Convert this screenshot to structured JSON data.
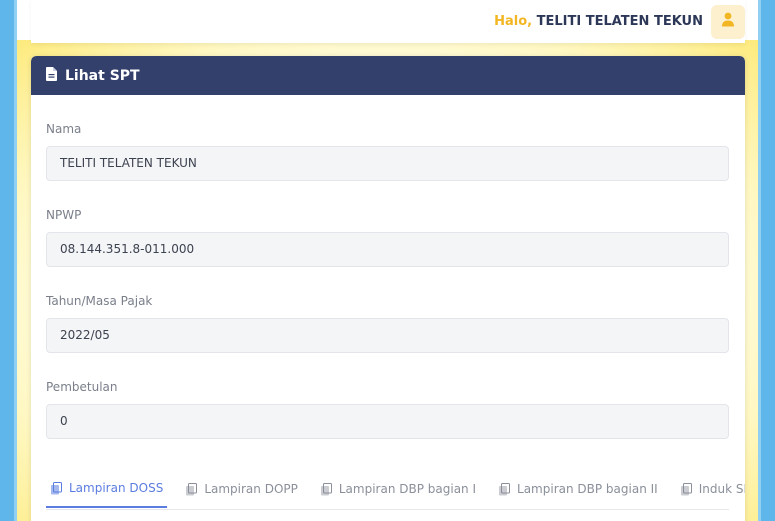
{
  "header": {
    "greeting": "Halo,",
    "user_name": "TELITI TELATEN TEKUN",
    "avatar_icon": "user-icon"
  },
  "card": {
    "title": "Lihat SPT",
    "title_icon": "document-icon"
  },
  "fields": {
    "nama": {
      "label": "Nama",
      "value": "TELITI TELATEN TEKUN"
    },
    "npwp": {
      "label": "NPWP",
      "value": "08.144.351.8-011.000"
    },
    "tahun_masa": {
      "label": "Tahun/Masa Pajak",
      "value": "2022/05"
    },
    "pembetulan": {
      "label": "Pembetulan",
      "value": "0"
    }
  },
  "tabs": [
    {
      "label": "Lampiran DOSS",
      "icon": "copy-icon",
      "active": true
    },
    {
      "label": "Lampiran DOPP",
      "icon": "copy-icon",
      "active": false
    },
    {
      "label": "Lampiran DBP bagian I",
      "icon": "copy-icon",
      "active": false
    },
    {
      "label": "Lampiran DBP bagian II",
      "icon": "copy-icon",
      "active": false
    },
    {
      "label": "Induk SPT",
      "icon": "copy-icon",
      "active": false
    }
  ],
  "colors": {
    "header_bg": "#33406b",
    "accent": "#5b7de0",
    "greeting": "#f3b623"
  }
}
